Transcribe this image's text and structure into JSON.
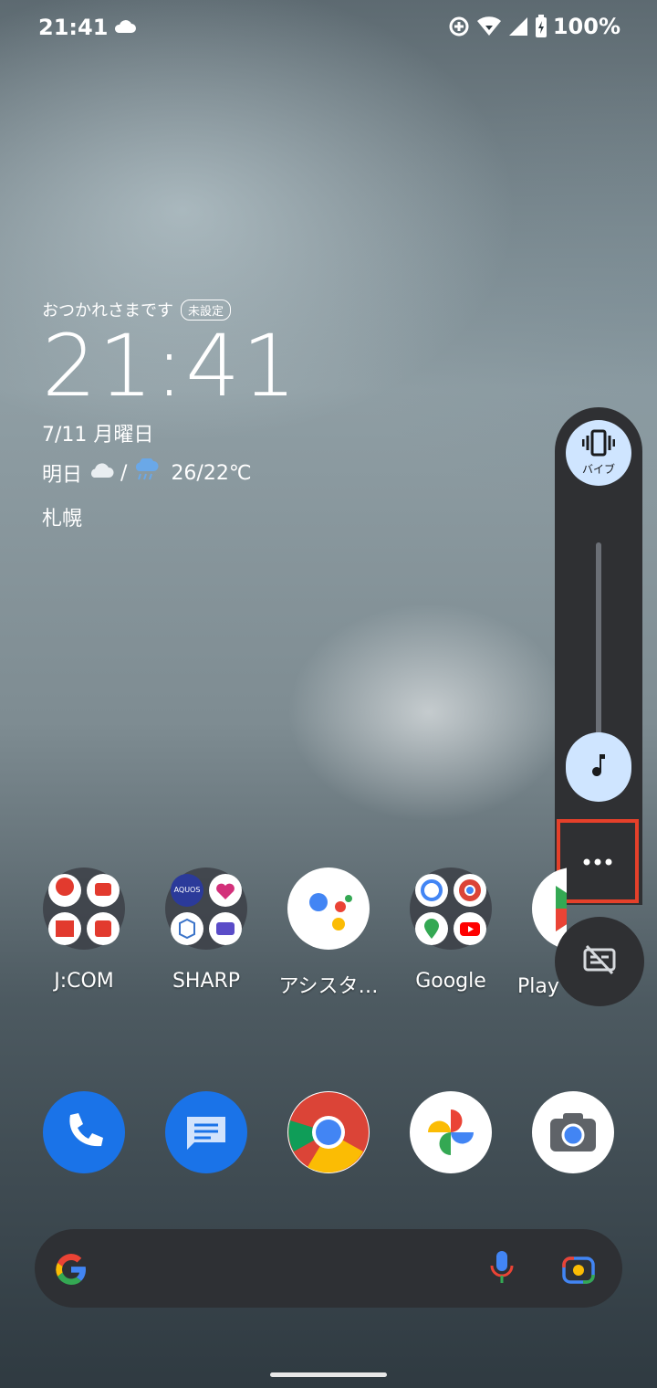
{
  "status_bar": {
    "time": "21:41",
    "battery": "100%"
  },
  "widget": {
    "greeting": "おつかれさまです",
    "badge": "未設定",
    "clock": "21:41",
    "date": "7/11 月曜日",
    "weather_day": "明日",
    "weather_sep": "/",
    "temperature": "26/22℃",
    "city": "札幌"
  },
  "volume_panel": {
    "ringer_mode_label": "バイブ",
    "level": 0.12
  },
  "apps": [
    {
      "label": "J:COM"
    },
    {
      "label": "SHARP"
    },
    {
      "label": "アシスタ…"
    },
    {
      "label": "Google"
    },
    {
      "label": "Play ストア"
    }
  ],
  "folder_sharp": {
    "mini_text": "AQUOS"
  },
  "colors": {
    "panel": "#2f3033",
    "accent": "#cfe5ff",
    "highlight": "#e5402a"
  }
}
